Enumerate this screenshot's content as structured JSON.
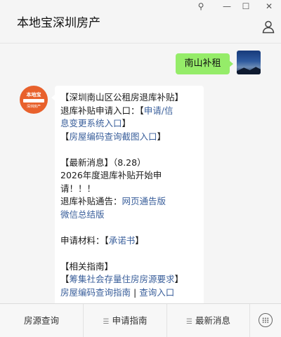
{
  "window": {
    "title": "本地宝深圳房产",
    "pin_icon": "⚲",
    "minimize_icon": "—",
    "maximize_icon": "☐",
    "close_icon": "✕"
  },
  "chat": {
    "sent_message": "南山补租",
    "bot_avatar_text": "本地宝",
    "bot_avatar_sub": "深圳房产",
    "reply_lines": [
      {
        "t": "【深圳南山区公租房退库补贴】"
      },
      {
        "t": "退库补贴申请入口：【",
        "link": "申请/信"
      },
      {
        "link": "息变更系统入口",
        "t2": "】"
      },
      {
        "t": "【",
        "link": "房屋编码查询截图入口",
        "t2": "】"
      },
      {
        "blank": true
      },
      {
        "t": "【最新消息】（8.28）"
      },
      {
        "t": "2026年度退库补贴开始申"
      },
      {
        "t": "请！！！"
      },
      {
        "t": "退库补贴通告：",
        "link": "网页通告版"
      },
      {
        "link": "微信总结版"
      },
      {
        "blank": true
      },
      {
        "t": "申请材料：【",
        "link": "承诺书",
        "t2": "】"
      },
      {
        "blank": true
      },
      {
        "t": "【相关指南】"
      },
      {
        "t": "【",
        "link": "筹集社会存量住房房源要求",
        "t2": "】"
      },
      {
        "link": "房屋编码查询指南",
        "t2": " | ",
        "link2": "查询入口"
      }
    ]
  },
  "bottom_menu": {
    "items": [
      "房源查询",
      "申请指南",
      "最新消息"
    ],
    "keyboard_icon": "keyboard-icon"
  },
  "colors": {
    "sent_bubble": "#95ec69",
    "link": "#3a5f9b",
    "avatar_orange": "#e8612c"
  }
}
